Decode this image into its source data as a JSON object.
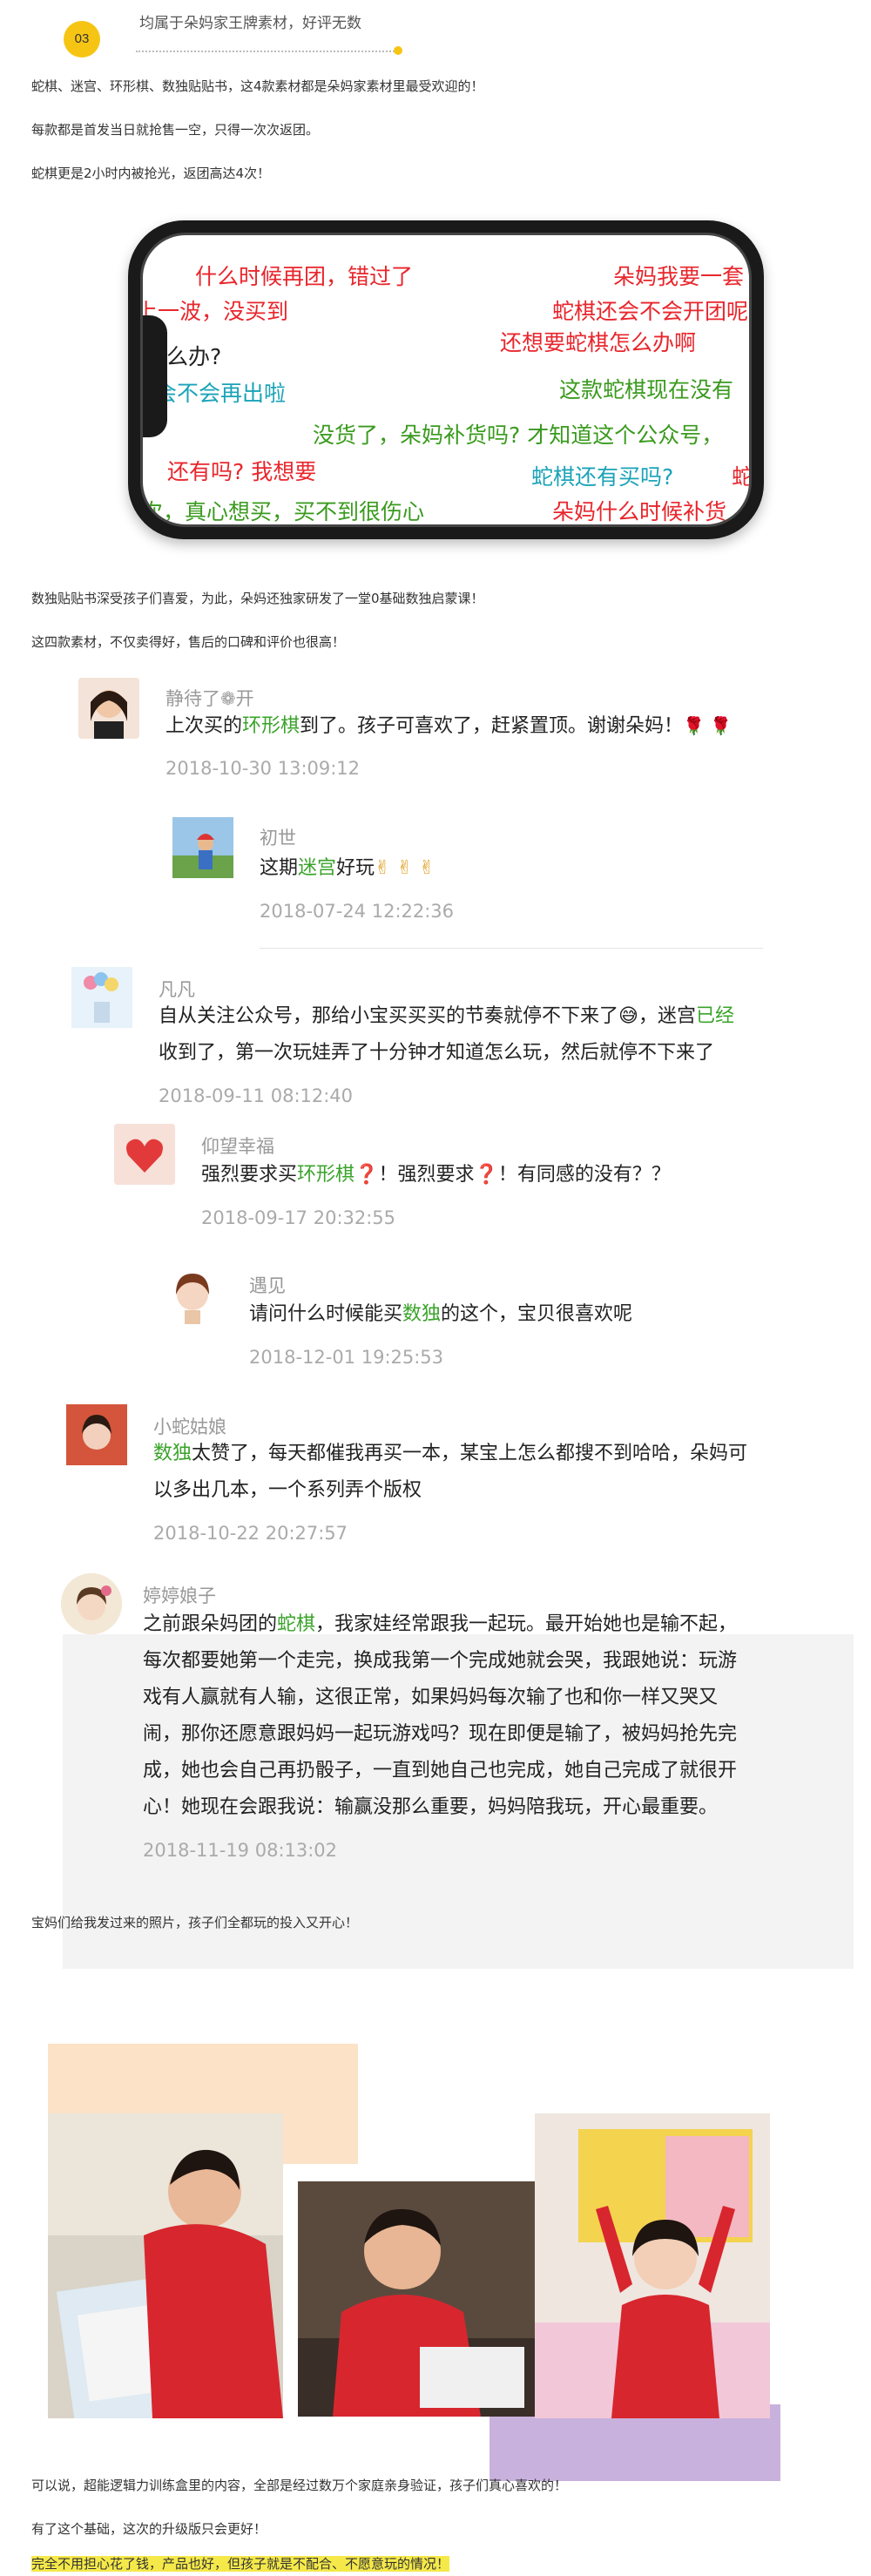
{
  "header": {
    "badge": "03",
    "title": "均属于朵妈家王牌素材，好评无数"
  },
  "intro": [
    "蛇棋、迷宫、环形棋、数独贴贴书，这4款素材都是朵妈家素材里最受欢迎的！",
    "每款都是首发当日就抢售一空，只得一次次返团。",
    "蛇棋更是2小时内被抢光，返团高达4次！"
  ],
  "danmu": [
    "什么时候再团，错过了",
    "朵妈我要一套",
    "上一波，没买到",
    "蛇棋还会不会开团呢",
    "还想要蛇棋怎么办啊",
    "怎么办?",
    "会不会再出啦",
    "这款蛇棋现在没有",
    "没货了，朵妈补货吗? 才知道这个公众号，",
    "还有吗? 我想要",
    "蛇棋还有买吗?",
    "次，真心想买，买不到很伤心",
    "朵妈什么时候补货",
    "蛇"
  ],
  "mid_text": [
    "数独贴贴书深受孩子们喜爱，为此，朵妈还独家研发了一堂0基础数独启蒙课！",
    "这四款素材，不仅卖得好，售后的口碑和评价也很高！"
  ],
  "comments": [
    {
      "name": "静待了❁开",
      "pre": "上次买的",
      "hl": "环形棋",
      "post": "到了。孩子可喜欢了，赶紧置顶。谢谢朵妈！",
      "emoji": "🌹 🌹",
      "time": "2018-10-30 13:09:12"
    },
    {
      "name": "初世",
      "pre": "这期",
      "hl": "迷宫",
      "post": "好玩",
      "emoji": "✌ ✌ ✌",
      "time": "2018-07-24 12:22:36"
    },
    {
      "name": "凡凡",
      "line1_pre": "自从关注公众号，那给小宝买买买的节奏就停不下来了",
      "emoji": "😅",
      "line1_mid": "，迷宫",
      "hl": "已经",
      "line2": "收到了，第一次玩娃弄了十分钟才知道怎么玩，然后就停不下来了",
      "time": "2018-09-11 08:12:40"
    },
    {
      "name": "仰望幸福",
      "pre": "强烈要求买",
      "hl": "环形棋",
      "q1": "❓",
      "mid": "！强烈要求",
      "q2": "❓",
      "post": "！有同感的没有？？",
      "time": "2018-09-17 20:32:55"
    },
    {
      "name": "遇见",
      "pre": "请问什么时候能买",
      "hl": "数独",
      "post": "的这个，宝贝很喜欢呢",
      "time": "2018-12-01 19:25:53"
    },
    {
      "name": "小蛇姑娘",
      "hl": "数独",
      "line1": "太赞了，每天都催我再买一本，某宝上怎么都搜不到哈哈，朵妈可",
      "line2": "以多出几本，一个系列弄个版权",
      "time": "2018-10-22 20:27:57"
    },
    {
      "name": "婷婷娘子",
      "pre": "之前跟朵妈团的",
      "hl": "蛇棋",
      "post": "，我家娃经常跟我一起玩。最开始她也是输不起，",
      "lines": [
        "每次都要她第一个走完，换成我第一个完成她就会哭，我跟她说：玩游",
        "戏有人赢就有人输，这很正常，如果妈妈每次输了也和你一样又哭又",
        "闹，那你还愿意跟妈妈一起玩游戏吗？现在即便是输了，被妈妈抢先完",
        "成，她也会自己再扔骰子，一直到她自己也完成，她自己完成了就很开",
        "心！她现在会跟我说：输赢没那么重要，妈妈陪我玩，开心最重要。"
      ],
      "time": "2018-11-19 08:13:02"
    }
  ],
  "photos_caption": "宝妈们给我发过来的照片，孩子们全都玩的投入又开心！",
  "outro": [
    "可以说，超能逻辑力训练盒里的内容，全部是经过数万个家庭亲身验证，孩子们真心喜欢的！",
    "有了这个基础，这次的升级版只会更好！",
    "完全不用担心花了钱，产品也好，但孩子就是不配合、不愿意玩的情况！"
  ],
  "colors": {
    "accent_yellow": "#f6c514",
    "highlight_green": "#3aa32a",
    "danmu_red": "#e8262c",
    "danmu_green": "#3a9a1e",
    "danmu_teal": "#1ba3b8"
  }
}
